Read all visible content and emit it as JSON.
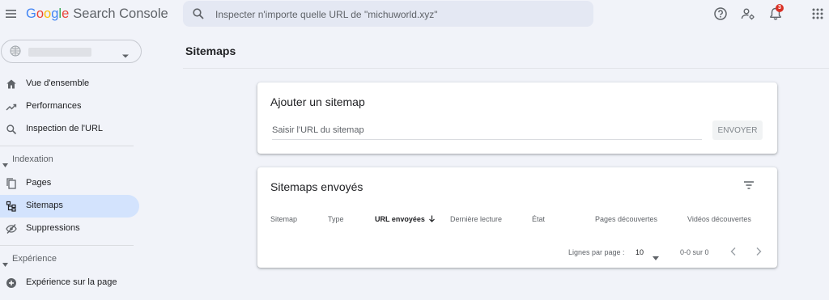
{
  "header": {
    "logo_google": [
      "G",
      "o",
      "o",
      "g",
      "l",
      "e"
    ],
    "logo_product": "Search Console",
    "search_placeholder": "Inspecter n'importe quelle URL de \"michuworld.xyz\"",
    "notification_count": "3"
  },
  "sidebar": {
    "property_name": "",
    "items_top": [
      {
        "label": "Vue d'ensemble",
        "icon": "home-icon"
      },
      {
        "label": "Performances",
        "icon": "trending-up-icon"
      },
      {
        "label": "Inspection de l'URL",
        "icon": "search-icon"
      }
    ],
    "section_indexation": "Indexation",
    "items_indexation": [
      {
        "label": "Pages",
        "icon": "pages-icon"
      },
      {
        "label": "Sitemaps",
        "icon": "sitemap-icon",
        "active": true
      },
      {
        "label": "Suppressions",
        "icon": "eye-off-icon"
      }
    ],
    "section_experience": "Expérience",
    "items_experience": [
      {
        "label": "Expérience sur la page",
        "icon": "plus-circle-icon"
      }
    ]
  },
  "main": {
    "page_title": "Sitemaps",
    "add_card": {
      "title": "Ajouter un sitemap",
      "input_placeholder": "Saisir l'URL du sitemap",
      "input_value": "",
      "submit_label": "ENVOYER"
    },
    "submitted_card": {
      "title": "Sitemaps envoyés",
      "columns": [
        "Sitemap",
        "Type",
        "URL envoyées",
        "Dernière lecture",
        "État",
        "Pages découvertes",
        "Vidéos découvertes"
      ],
      "sorted_column": "URL envoyées",
      "sort_direction": "descending",
      "rows": [],
      "pagination": {
        "rows_per_page_label": "Lignes par page :",
        "rows_per_page_value": "10",
        "range_label": "0-0 sur 0"
      }
    }
  },
  "colors": {
    "background": "#f1f3f9",
    "active_nav": "#d3e3fd",
    "badge": "#d93025"
  }
}
